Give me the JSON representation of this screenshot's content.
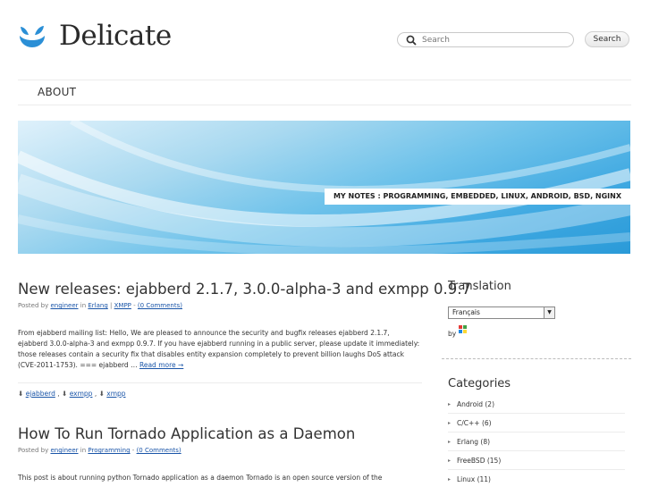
{
  "site": {
    "name": "Delicate",
    "search_placeholder": "Search",
    "search_button": "Search"
  },
  "nav": {
    "items": [
      "ABOUT"
    ]
  },
  "banner": {
    "caption": "MY NOTES : PROGRAMMING, EMBEDDED, LINUX, ANDROID, BSD, NGINX"
  },
  "posts": [
    {
      "title": "New releases: ejabberd 2.1.7, 3.0.0-alpha-3 and exmpp 0.9.7",
      "posted_by": "Posted by",
      "author": "engineer",
      "in": "in",
      "cat1": "Erlang",
      "sep": "|",
      "cat2": "XMPP",
      "dash": "-",
      "comments": "(0 Comments)",
      "excerpt": "From ejabberd mailing list: Hello, We are pleased to announce the security and bugfix releases ejabberd 2.1.7, ejabberd 3.0.0-alpha-3 and exmpp 0.9.7. If you have ejabberd running in a public server, please update it immediately: those releases contain a security fix that disables entity expansion completely to prevent billion laughs DoS attack (CVE-2011-1753). === ejabberd …",
      "read_more": "Read more →",
      "tags": [
        "ejabberd",
        "exmpp",
        "xmpp"
      ]
    },
    {
      "title": "How To Run Tornado Application as a Daemon",
      "posted_by": "Posted by",
      "author": "engineer",
      "in": "in",
      "cat1": "Programming",
      "dash": "-",
      "comments": "(0 Comments)",
      "excerpt": "This post is about running python Tornado application as a daemon Tornado is an open source version of the"
    }
  ],
  "sidebar": {
    "translation": {
      "title": "Translation",
      "selected_language": "Français",
      "by": "by"
    },
    "categories": {
      "title": "Categories",
      "items": [
        "Android (2)",
        "C/C++ (6)",
        "Erlang (8)",
        "FreeBSD (15)",
        "Linux (11)"
      ]
    }
  },
  "colors": {
    "link": "#1a55a8",
    "logo_blue": "#2b8fd6",
    "banner_blue": "#3ea8e1"
  }
}
